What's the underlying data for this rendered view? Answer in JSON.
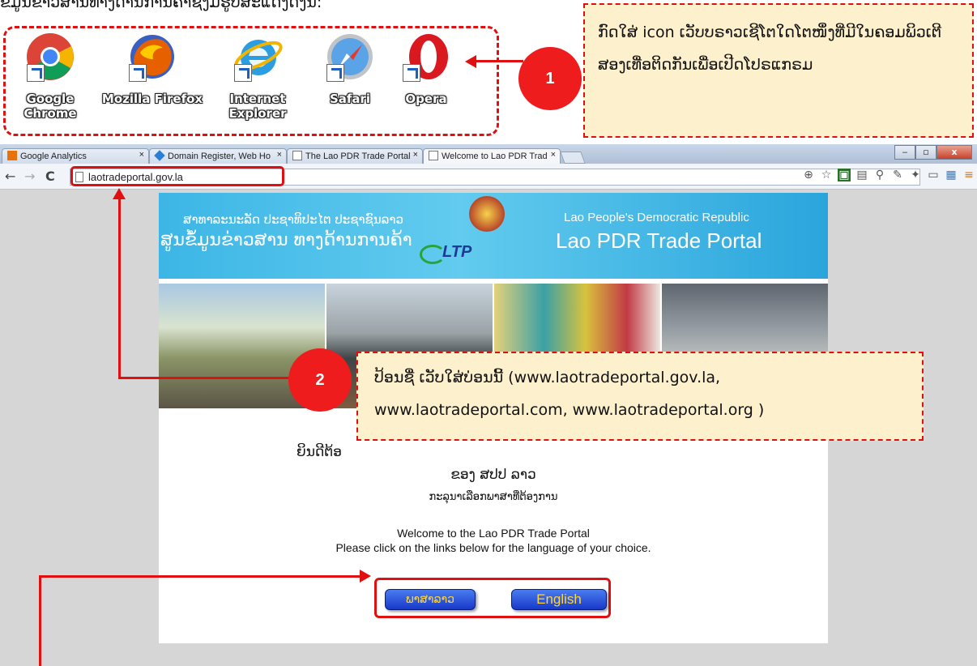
{
  "document": {
    "heading": "ຂໍ້ມູນຂ່າວສານທາງດ້ານການຄ້າຊຶ່ງມີຮູບສະແດງດັ່ງນີ້:"
  },
  "desktop_icons": [
    {
      "label_1": "Google",
      "label_2": "Chrome",
      "icon": "chrome-icon"
    },
    {
      "label_1": "Mozilla Firefox",
      "label_2": "",
      "icon": "firefox-icon"
    },
    {
      "label_1": "Internet",
      "label_2": "Explorer",
      "icon": "internet-explorer-icon"
    },
    {
      "label_1": "Safari",
      "label_2": "",
      "icon": "safari-icon"
    },
    {
      "label_1": "Opera",
      "label_2": "",
      "icon": "opera-icon"
    }
  ],
  "callouts": [
    {
      "number": "1",
      "text": "ກົດໃສ່ icon ເວັບບຣາວເຊີໂຕໃດໂຕໜຶ່ງທີ່ມີໃນຄອມພິວເຕີ ສອງເທື່ອຕິດກັນເພື່ອເປີດໂປຣແກຣມ"
    },
    {
      "number": "2",
      "text": "ປ້ອນຊື່ ເວັບໃສ່ບ່ອນນີ້ (www.laotradeportal.gov.la, www.laotradeportal.com, www.laotradeportal.org )"
    }
  ],
  "browser": {
    "tabs": [
      {
        "title": "Google Analytics",
        "icon": "analytics-icon",
        "color": "#e8710a"
      },
      {
        "title": "Domain Register, Web Ho",
        "icon": "diamond-icon",
        "color": "#2a7fd4"
      },
      {
        "title": "The Lao PDR Trade Portal",
        "icon": "page-icon",
        "color": "#ffffff"
      },
      {
        "title": "Welcome to Lao PDR Trad",
        "icon": "page-icon",
        "color": "#ffffff"
      }
    ],
    "tab_close": "×",
    "url": "laotradeportal.gov.la",
    "nav": {
      "back": "←",
      "forward": "→",
      "reload": "C"
    }
  },
  "webpage": {
    "banner": {
      "lao_small": "ສາທາລະນະລັດ ປະຊາທິປະໄຕ ປະຊາຊົນລາວ",
      "lao_big": "ສູນຂໍ້ມູນຂ່າວສານ ທາງດ້ານການຄ້າ",
      "en_small": "Lao People's Democratic Republic",
      "en_big": "Lao PDR Trade Portal",
      "logo": "LTP"
    },
    "welcome_lao_1": "ຍິນດີຕ້ອ",
    "welcome_lao_2": "ຂອງ ສປປ ລາວ",
    "welcome_lao_3": "ກະລຸນາເລືອກພາສາທີ່ຕ້ອງການ",
    "welcome_en_1": "Welcome to the Lao PDR Trade Portal",
    "welcome_en_2": "Please click on the links below for the language of your choice.",
    "buttons": {
      "lao": "ພາສາລາວ",
      "english": "English"
    }
  }
}
